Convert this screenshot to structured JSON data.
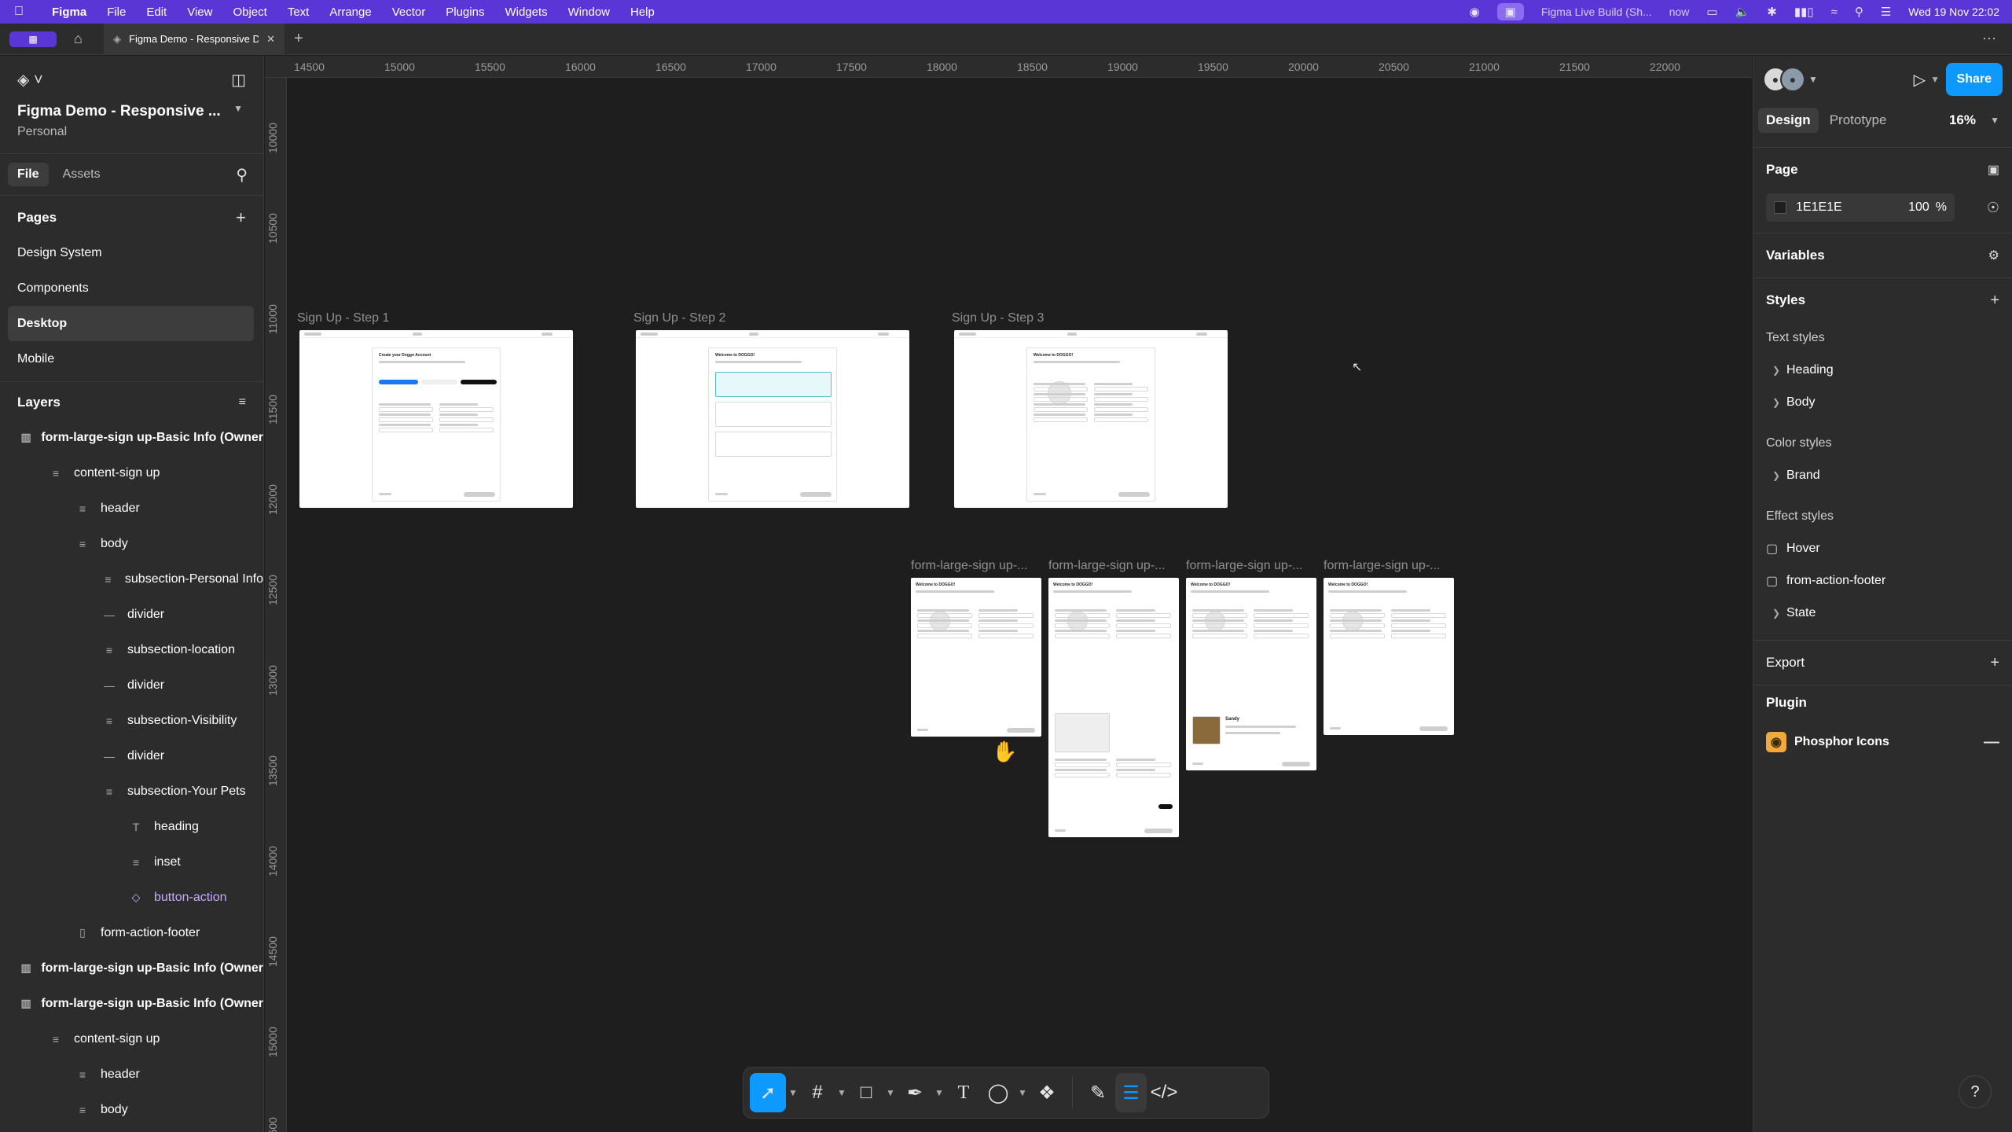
{
  "menubar": {
    "app": "Figma",
    "items": [
      "File",
      "Edit",
      "View",
      "Object",
      "Text",
      "Arrange",
      "Vector",
      "Plugins",
      "Widgets",
      "Window",
      "Help"
    ],
    "live_build": "Figma Live Build (Sh...",
    "live_status": "now",
    "datetime": "Wed 19 Nov  22:02"
  },
  "tabbar": {
    "tab_title": "Figma Demo - Responsive Design"
  },
  "left_panel": {
    "project_name": "Figma Demo - Responsive ...",
    "project_team": "Personal",
    "tabs": {
      "file": "File",
      "assets": "Assets"
    },
    "pages_title": "Pages",
    "pages": [
      "Design System",
      "Components",
      "Desktop",
      "Mobile"
    ],
    "selected_page": "Desktop",
    "layers_title": "Layers",
    "layers": [
      {
        "label": "form-large-sign up-Basic Info (Owner",
        "indent": 0,
        "icon": "frame",
        "bold": true
      },
      {
        "label": "content-sign up",
        "indent": 1,
        "icon": "autolayout"
      },
      {
        "label": "header",
        "indent": 2,
        "icon": "autolayout"
      },
      {
        "label": "body",
        "indent": 2,
        "icon": "autolayout"
      },
      {
        "label": "subsection-Personal Info",
        "indent": 3,
        "icon": "autolayout"
      },
      {
        "label": "divider",
        "indent": 3,
        "icon": "line"
      },
      {
        "label": "subsection-location",
        "indent": 3,
        "icon": "autolayout"
      },
      {
        "label": "divider",
        "indent": 3,
        "icon": "line"
      },
      {
        "label": "subsection-Visibility",
        "indent": 3,
        "icon": "autolayout"
      },
      {
        "label": "divider",
        "indent": 3,
        "icon": "line"
      },
      {
        "label": "subsection-Your Pets",
        "indent": 3,
        "icon": "autolayout"
      },
      {
        "label": "heading",
        "indent": 4,
        "icon": "text"
      },
      {
        "label": "inset",
        "indent": 4,
        "icon": "autolayout"
      },
      {
        "label": "button-action",
        "indent": 4,
        "icon": "component"
      },
      {
        "label": "form-action-footer",
        "indent": 2,
        "icon": "frame-small"
      },
      {
        "label": "form-large-sign up-Basic Info (Owner",
        "indent": 0,
        "icon": "frame",
        "bold": true
      },
      {
        "label": "form-large-sign up-Basic Info (Owner",
        "indent": 0,
        "icon": "frame",
        "bold": true
      },
      {
        "label": "content-sign up",
        "indent": 1,
        "icon": "autolayout"
      },
      {
        "label": "header",
        "indent": 2,
        "icon": "autolayout"
      },
      {
        "label": "body",
        "indent": 2,
        "icon": "autolayout"
      }
    ]
  },
  "canvas": {
    "ruler_x": [
      "14500",
      "15000",
      "15500",
      "16000",
      "16500",
      "17000",
      "17500",
      "18000",
      "18500",
      "19000",
      "19500",
      "20000",
      "20500",
      "21000",
      "21500",
      "22000"
    ],
    "ruler_y": [
      "10000",
      "10500",
      "11000",
      "11500",
      "12000",
      "12500",
      "13000",
      "13500",
      "14000",
      "14500",
      "15000",
      "15500"
    ],
    "frames_top": [
      {
        "label": "Sign Up - Step 1",
        "heading": "Create your Doggo Account"
      },
      {
        "label": "Sign Up - Step 2",
        "heading": "Welcome to DOGGO!"
      },
      {
        "label": "Sign Up - Step 3",
        "heading": "Welcome to DOGGO!"
      }
    ],
    "frames_bottom": [
      {
        "label": "form-large-sign up-...",
        "heading": "Welcome to DOGGO!"
      },
      {
        "label": "form-large-sign up-...",
        "heading": "Welcome to DOGGO!"
      },
      {
        "label": "form-large-sign up-...",
        "heading": "Welcome to DOGGO!"
      },
      {
        "label": "form-large-sign up-...",
        "heading": "Welcome to DOGGO!"
      }
    ],
    "pet_name": "Sandy"
  },
  "right_panel": {
    "tabs": {
      "design": "Design",
      "prototype": "Prototype"
    },
    "zoom": "16%",
    "share_label": "Share",
    "page_title": "Page",
    "page_fill_hex": "1E1E1E",
    "page_fill_opacity": "100",
    "page_fill_unit": "%",
    "variables_title": "Variables",
    "styles_title": "Styles",
    "text_styles_title": "Text styles",
    "text_styles": [
      "Heading",
      "Body"
    ],
    "color_styles_title": "Color styles",
    "color_styles": [
      "Brand"
    ],
    "effect_styles_title": "Effect styles",
    "effect_styles": [
      {
        "label": "Hover",
        "kind": "effect"
      },
      {
        "label": "from-action-footer",
        "kind": "effect"
      },
      {
        "label": "State",
        "kind": "group"
      }
    ],
    "export_title": "Export",
    "plugin_title": "Plugin",
    "plugin_name": "Phosphor Icons"
  },
  "colors": {
    "menubar": "#5a36d6",
    "accent": "#0d99ff",
    "component": "#c9a9ff",
    "canvas": "#1e1e1e",
    "panel": "#2c2c2c"
  }
}
